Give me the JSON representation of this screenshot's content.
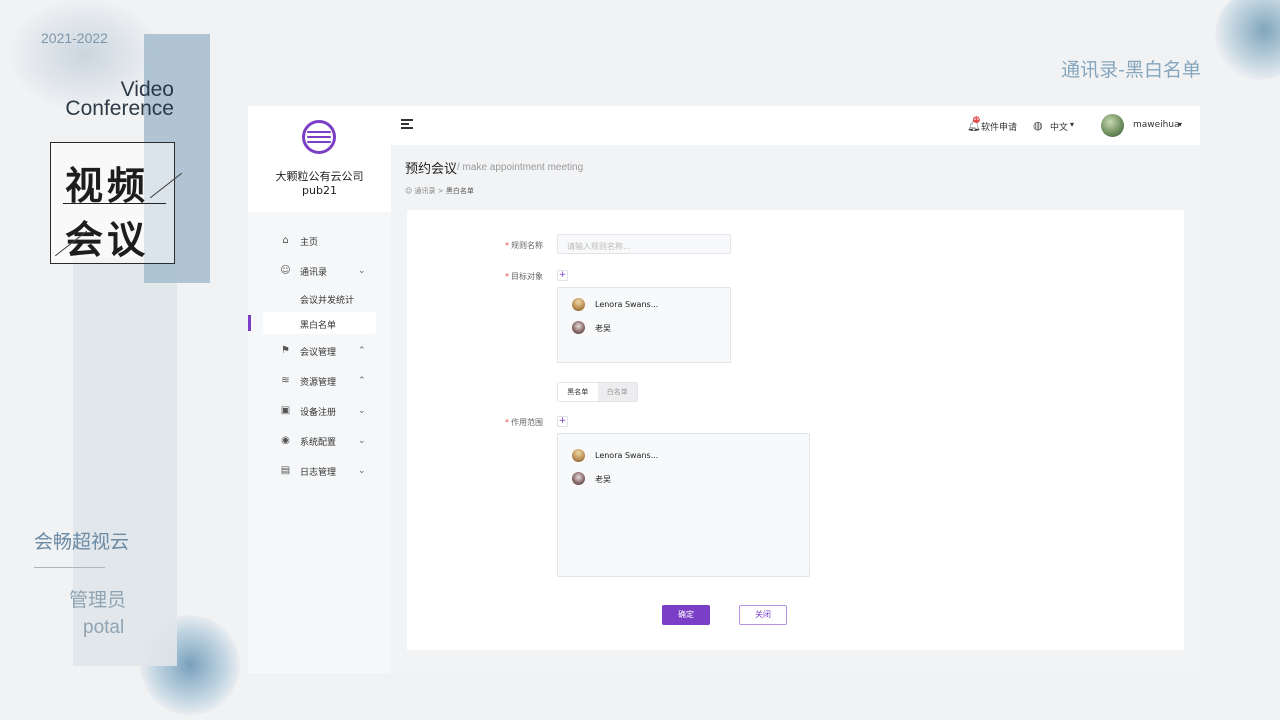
{
  "slide": {
    "year": "2021-2022",
    "brand_en_line1": "Video",
    "brand_en_line2": "Conference",
    "seal_line1": "视频",
    "seal_line2": "会议",
    "product": "会畅超视云",
    "role_cn": "管理员",
    "role_en": "potal",
    "section_title": "通讯录-黑白名单"
  },
  "colors": {
    "accent": "#7a3fc6",
    "required": "#e54b4b",
    "sidebar_bg": "#f6f7f8"
  },
  "org": {
    "name": "大颗粒公有云公司",
    "code": "pub21"
  },
  "sidebar": {
    "items": [
      {
        "label": "主页",
        "icon": "home-icon"
      },
      {
        "label": "通讯录",
        "icon": "contacts-icon",
        "chevron": "⌄"
      },
      {
        "label": "会议管理",
        "icon": "meeting-icon",
        "chevron": "⌃"
      },
      {
        "label": "资源管理",
        "icon": "layers-icon",
        "chevron": "⌃"
      },
      {
        "label": "设备注册",
        "icon": "device-icon",
        "chevron": "⌄"
      },
      {
        "label": "系统配置",
        "icon": "settings-icon",
        "chevron": "⌄"
      },
      {
        "label": "日志管理",
        "icon": "log-icon",
        "chevron": "⌄"
      }
    ],
    "sub_items": [
      {
        "label": "会议并发统计"
      },
      {
        "label": "黑白名单",
        "active": true
      }
    ]
  },
  "topbar": {
    "notify_count": "10",
    "software_apply": "软件申请",
    "language": "中文",
    "username": "maweihua"
  },
  "page": {
    "title": "预约会议",
    "subtitle": "/ make appointment meeting",
    "breadcrumb_1": "通讯录",
    "breadcrumb_sep": ">",
    "breadcrumb_2": "黑白名单"
  },
  "form": {
    "rule_name_label": "规则名称",
    "rule_name_placeholder": "请输入规则名称...",
    "target_label": "目标对象",
    "scope_label": "作用范围",
    "targets": [
      {
        "name": "Lenora Swans..."
      },
      {
        "name": "老吴"
      }
    ],
    "scope": [
      {
        "name": "Lenora Swans..."
      },
      {
        "name": "老吴"
      }
    ],
    "seg_black": "黑名单",
    "seg_white": "白名单",
    "ok": "确定",
    "close": "关闭"
  }
}
